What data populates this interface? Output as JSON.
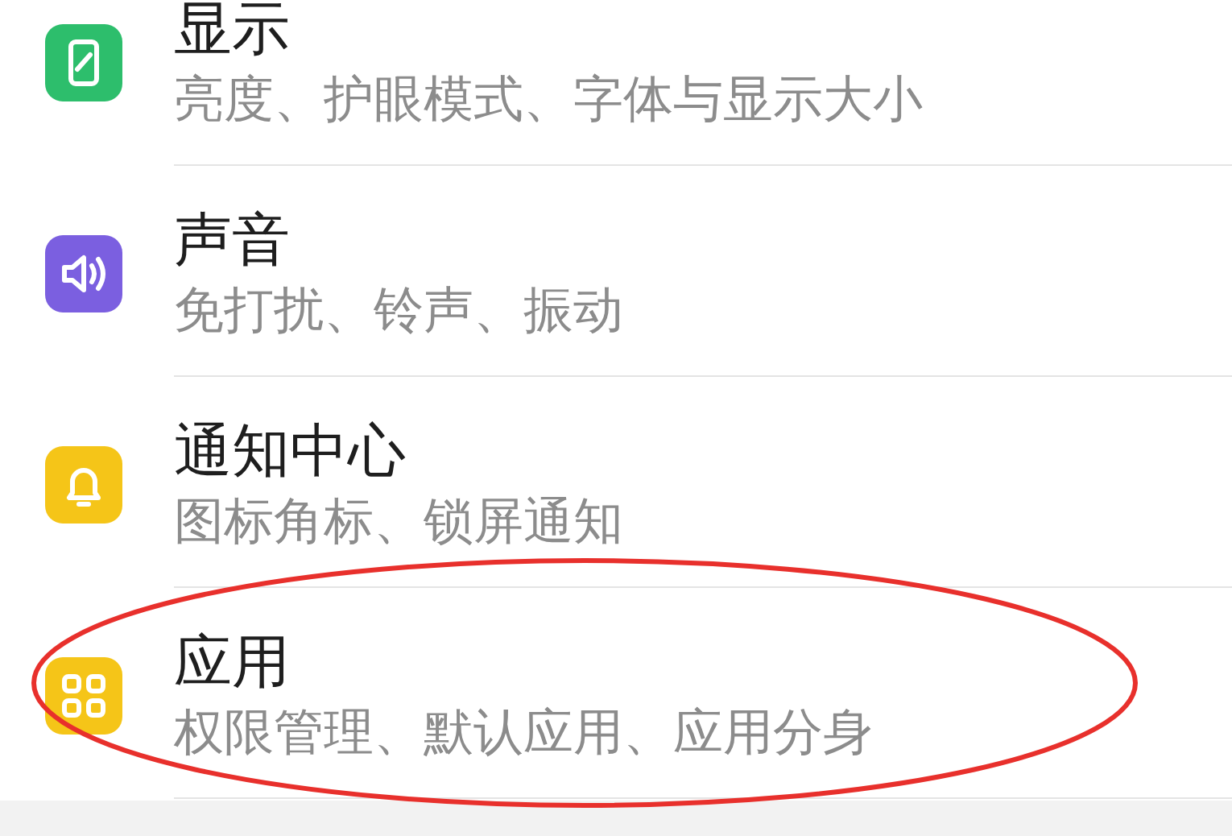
{
  "settings": [
    {
      "kind": "display",
      "color": "#2dbe6c",
      "title": "显示",
      "subtitle": "亮度、护眼模式、字体与显示大小",
      "circled": false
    },
    {
      "kind": "sound",
      "color": "#7b5fe0",
      "title": "声音",
      "subtitle": "免打扰、铃声、振动",
      "circled": false
    },
    {
      "kind": "bell",
      "color": "#f5c518",
      "title": "通知中心",
      "subtitle": "图标角标、锁屏通知",
      "circled": false
    },
    {
      "kind": "apps",
      "color": "#f5c518",
      "title": "应用",
      "subtitle": "权限管理、默认应用、应用分身",
      "circled": true
    }
  ]
}
